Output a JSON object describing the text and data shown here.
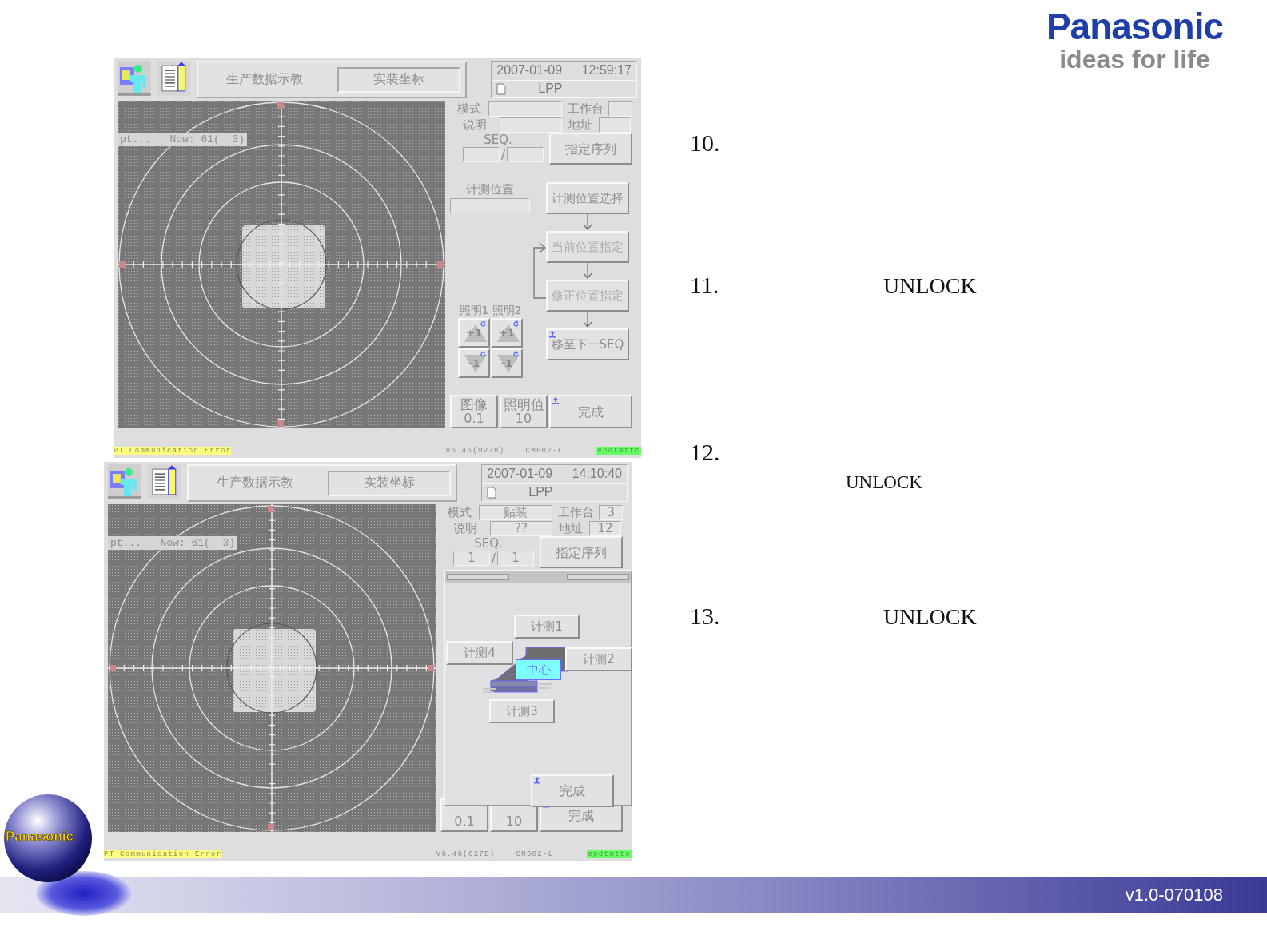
{
  "logo": {
    "wordmark": "Panasonic",
    "tagline": "ideas for life"
  },
  "screens": [
    {
      "tabs": [
        {
          "label": "生产数据示教",
          "selected": false
        },
        {
          "label": "实装坐标",
          "selected": true
        }
      ],
      "date": "2007-01-09",
      "time": "12:59:17",
      "file": "LPP",
      "readout": "pt...   Now: 61(  3)",
      "fields": [
        {
          "label": "模式"
        },
        {
          "label": "工作台"
        },
        {
          "label": "说明"
        },
        {
          "label": "地址"
        }
      ],
      "seq": {
        "label": "SEQ.",
        "separator": "/"
      },
      "seq_button": "指定序列",
      "measure_panel": {
        "position_label": "计测位置",
        "steps": [
          {
            "label": "计测位置选择",
            "disabled": false
          },
          {
            "label": "当前位置指定",
            "disabled": true
          },
          {
            "label": "修正位置指定",
            "disabled": true
          },
          {
            "label": "移至下一SEQ",
            "disabled": false
          }
        ],
        "lights": [
          {
            "label": "照明1",
            "up": "+1",
            "down": "-1"
          },
          {
            "label": "照明2",
            "up": "+1",
            "down": "-1"
          }
        ]
      },
      "footer_buttons": [
        {
          "label": "图像",
          "value": "0.1"
        },
        {
          "label": "照明值",
          "value": "10"
        },
        {
          "label": "完成"
        }
      ],
      "status": {
        "error": "PT Communication Error",
        "version": "V6.46(027B)",
        "model": "CM602-L",
        "code": "epdtmttc"
      }
    },
    {
      "tabs": [
        {
          "label": "生产数据示教",
          "selected": false
        },
        {
          "label": "实装坐标",
          "selected": true
        }
      ],
      "date": "2007-01-09",
      "time": "14:10:40",
      "file": "LPP",
      "readout": "pt...   Now: 61(  3)",
      "fields": [
        {
          "label": "模式",
          "value": "贴装"
        },
        {
          "label": "工作台",
          "value": "3"
        },
        {
          "label": "说明",
          "value": "??"
        },
        {
          "label": "地址",
          "value": "12"
        }
      ],
      "seq": {
        "label": "SEQ.",
        "separator": "/",
        "current": "1",
        "total": "1"
      },
      "seq_button": "指定序列",
      "popup": {
        "points": [
          {
            "label": "计测1",
            "selected": false
          },
          {
            "label": "计测2",
            "selected": false
          },
          {
            "label": "计测3",
            "selected": false
          },
          {
            "label": "计测4",
            "selected": false
          },
          {
            "label": "中心",
            "selected": true
          }
        ],
        "done": "完成"
      },
      "footer_buttons": [
        {
          "value": "0.1"
        },
        {
          "value": "10"
        },
        {
          "label": "完成"
        }
      ],
      "status": {
        "error": "PT Communication Error",
        "version": "V6.46(027B)",
        "model": "CM602-L",
        "code": "epdtmtto"
      }
    }
  ],
  "steps": [
    {
      "number": "10.",
      "kind": "plain"
    },
    {
      "number": "11.",
      "kind": "inline",
      "text": "UNLOCK"
    },
    {
      "number": "12.",
      "kind": "below",
      "text": "UNLOCK"
    },
    {
      "number": "13.",
      "kind": "inline",
      "text": "UNLOCK"
    }
  ],
  "version": "v1.0-070108",
  "badge": "Panasonic"
}
